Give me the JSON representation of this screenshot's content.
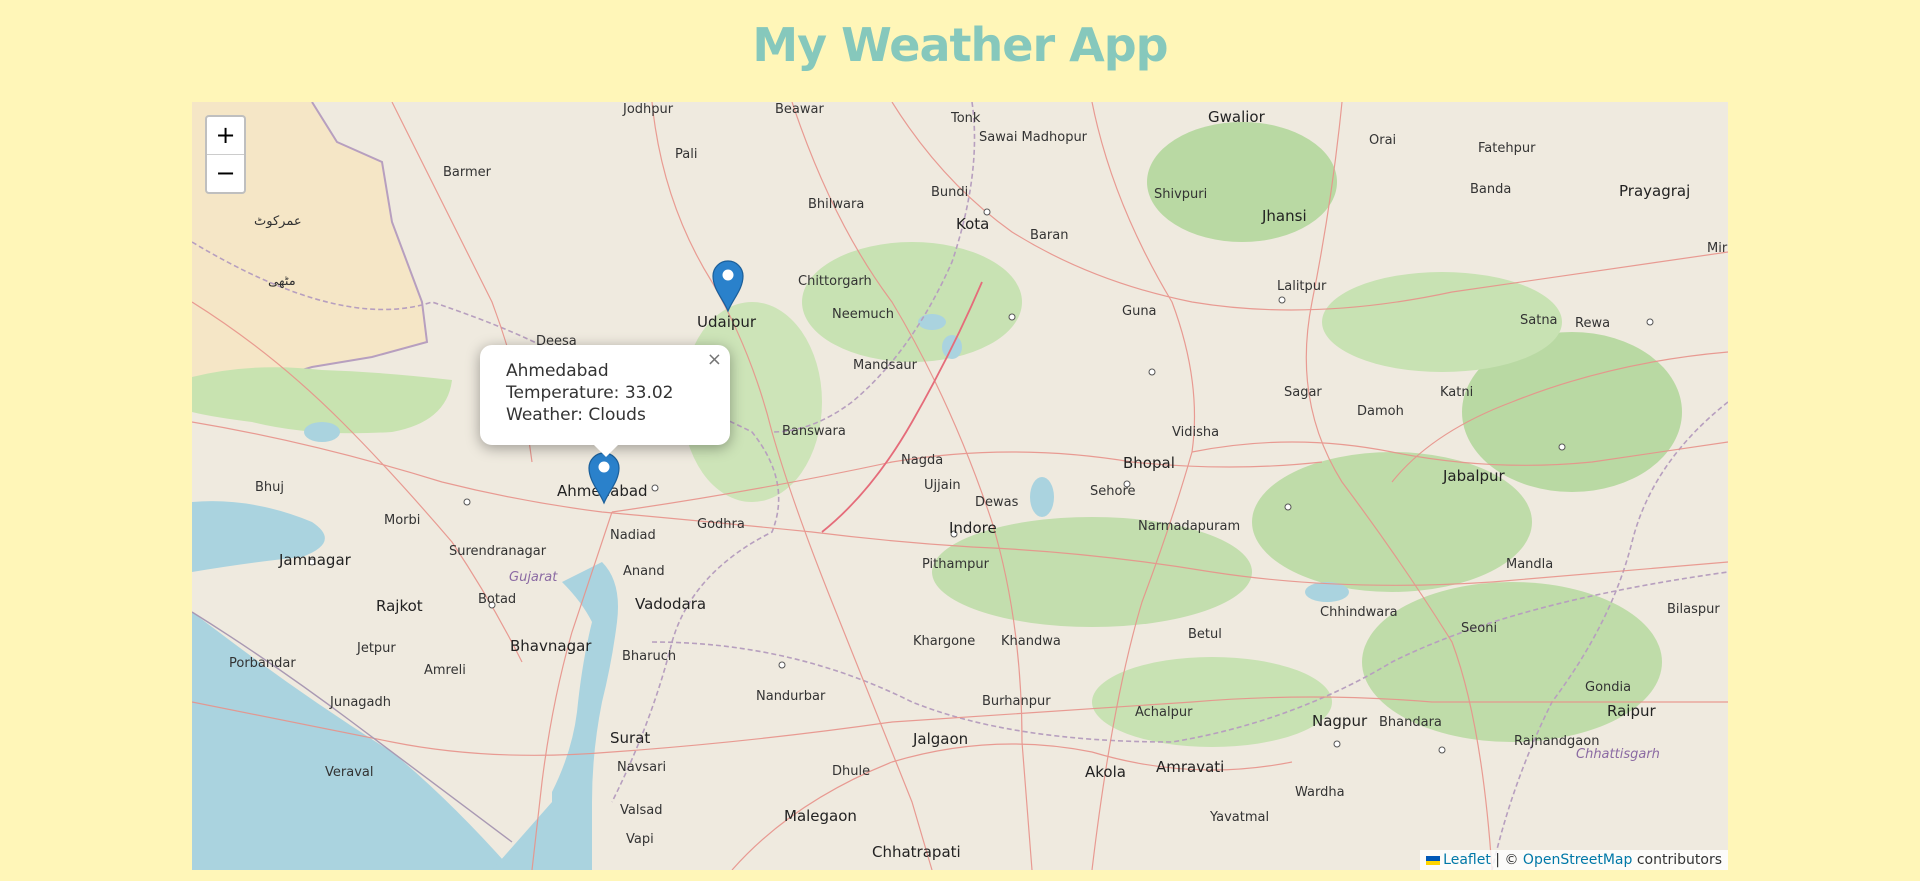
{
  "app": {
    "title": "My Weather App"
  },
  "map": {
    "zoom_in_label": "+",
    "zoom_out_label": "−",
    "cities": {
      "jodhpur": "Jodhpur",
      "beawar": "Beawar",
      "tonk": "Tonk",
      "sawai_madhopur": "Sawai Madhopur",
      "gwalior": "Gwalior",
      "orai": "Orai",
      "fatehpur": "Fatehpur",
      "barmer": "Barmer",
      "pali": "Pali",
      "bhilwara": "Bhilwara",
      "bundi": "Bundi",
      "shivpuri": "Shivpuri",
      "jhansi": "Jhansi",
      "banda": "Banda",
      "prayagraj": "Prayagraj",
      "umarkot": "عمرکوٹ",
      "kota": "Kota",
      "baran": "Baran",
      "mithi": "مٹھی",
      "chittorgarh": "Chittorgarh",
      "lalitpur": "Lalitpur",
      "satna": "Satna",
      "rewa": "Rewa",
      "udaipur": "Udaipur",
      "neemuch": "Neemuch",
      "guna": "Guna",
      "deesa": "Deesa",
      "mandsaur": "Mandsaur",
      "sagar": "Sagar",
      "katni": "Katni",
      "damoh": "Damoh",
      "banswara": "Banswara",
      "vidisha": "Vidisha",
      "nagda": "Nagda",
      "bhopal": "Bhopal",
      "jabalpur": "Jabalpur",
      "bhuj": "Bhuj",
      "ahmedabad": "Ahmedabad",
      "ujjain": "Ujjain",
      "dewas": "Dewas",
      "sehore": "Sehore",
      "morbi": "Morbi",
      "nadiad": "Nadiad",
      "godhra": "Godhra",
      "indore": "Indore",
      "narmadapuram": "Narmadapuram",
      "surendranagar": "Surendranagar",
      "jamnagar": "Jamnagar",
      "gujarat": "Gujarat",
      "anand": "Anand",
      "pithampur": "Pithampur",
      "mandla": "Mandla",
      "rajkot": "Rajkot",
      "botad": "Botad",
      "vadodara": "Vadodara",
      "chhindwara": "Chhindwara",
      "seoni": "Seoni",
      "bilaspur": "Bilaspur",
      "jetpur": "Jetpur",
      "bhavnagar": "Bhavnagar",
      "bharuch": "Bharuch",
      "khargone": "Khargone",
      "khandwa": "Khandwa",
      "betul": "Betul",
      "porbandar": "Porbandar",
      "amreli": "Amreli",
      "gondia": "Gondia",
      "junagadh": "Junagadh",
      "nandurbar": "Nandurbar",
      "burhanpur": "Burhanpur",
      "achalpur": "Achalpur",
      "raipur": "Raipur",
      "nagpur": "Nagpur",
      "bhandara": "Bhandara",
      "surat": "Surat",
      "jalgaon": "Jalgaon",
      "rajnandgaon": "Rajnandgaon",
      "chhattisgarh": "Chhattisgarh",
      "veraval": "Veraval",
      "navsari": "Navsari",
      "dhule": "Dhule",
      "akola": "Akola",
      "amravati": "Amravati",
      "valsad": "Valsad",
      "wardha": "Wardha",
      "yavatmal": "Yavatmal",
      "malegaon": "Malegaon",
      "vapi": "Vapi",
      "chhatrapati": "Chhatrapati",
      "mir": "Mir"
    },
    "markers": [
      {
        "city": "Udaipur",
        "icon": "map-pin-icon"
      },
      {
        "city": "Ahmedabad",
        "icon": "map-pin-icon"
      }
    ],
    "popup": {
      "line1": "Ahmedabad",
      "line2": "Temperature: 33.02",
      "line3": "Weather: Clouds",
      "close_label": "×"
    },
    "attribution": {
      "leaflet": "Leaflet",
      "separator": "| ©",
      "osm": "OpenStreetMap",
      "contributors": "contributors"
    },
    "colors": {
      "land": "#efeadf",
      "water": "#aad3df",
      "forest": "#a9d299",
      "pakistan": "#f4e7c4",
      "road": "#e8928a",
      "marker": "#2a81cb"
    }
  }
}
